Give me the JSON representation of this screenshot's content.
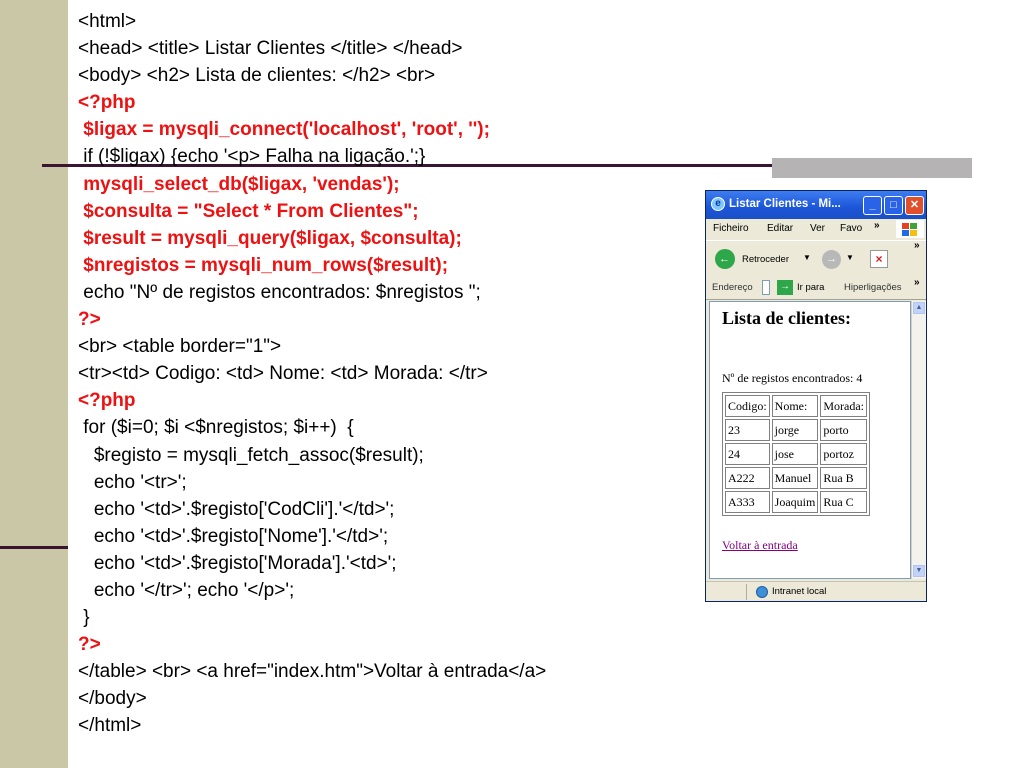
{
  "code_lines": [
    {
      "text": "<html>",
      "red": false
    },
    {
      "text": "<head> <title> Listar Clientes </title> </head>",
      "red": false
    },
    {
      "text": "<body> <h2> Lista de clientes: </h2> <br>",
      "red": false
    },
    {
      "text": "<?php",
      "red": true
    },
    {
      "text": " $ligax = mysqli_connect('localhost', 'root', '');",
      "red": true
    },
    {
      "text": " if (!$ligax) {echo '<p> Falha na ligação.';}",
      "red": false
    },
    {
      "text": " mysqli_select_db($ligax, 'vendas');",
      "red": true
    },
    {
      "text": " $consulta = \"Select * From Clientes\";",
      "red": true
    },
    {
      "text": " $result = mysqli_query($ligax, $consulta);",
      "red": true
    },
    {
      "text": " $nregistos = mysqli_num_rows($result);",
      "red": true
    },
    {
      "text": " echo \"Nº de registos encontrados: $nregistos \";",
      "red": false
    },
    {
      "text": "?>",
      "red": true
    },
    {
      "text": "<br> <table border=\"1\">",
      "red": false
    },
    {
      "text": "<tr><td> Codigo: <td> Nome: <td> Morada: </tr>",
      "red": false
    },
    {
      "text": "<?php",
      "red": true
    },
    {
      "text": " for ($i=0; $i <$nregistos; $i++)  {",
      "red": false
    },
    {
      "text": "   $registo = mysqli_fetch_assoc($result);",
      "red": false
    },
    {
      "text": "   echo '<tr>';",
      "red": false
    },
    {
      "text": "   echo '<td>'.$registo['CodCli'].'</td>';",
      "red": false
    },
    {
      "text": "   echo '<td>'.$registo['Nome'].'</td>';",
      "red": false
    },
    {
      "text": "   echo '<td>'.$registo['Morada'].'<td>';",
      "red": false
    },
    {
      "text": "   echo '</tr>'; echo '</p>';",
      "red": false
    },
    {
      "text": " }",
      "red": false
    },
    {
      "text": "?>",
      "red": true
    },
    {
      "text": "</table> <br> <a href=\"index.htm\">Voltar à entrada</a>",
      "red": false
    },
    {
      "text": "</body>",
      "red": false
    },
    {
      "text": "</html>",
      "red": false
    }
  ],
  "colors": {
    "code_red": "#ee1111",
    "link": "#800080"
  },
  "browser": {
    "title": "Listar Clientes - Mi...",
    "menu": [
      "Ficheiro",
      "Editar",
      "Ver",
      "Favo"
    ],
    "more": "»",
    "back_label": "Retroceder",
    "address_label": "Endereço",
    "go_label": "Ir para",
    "links_label": "Hiperligações",
    "status_text": "Intranet local",
    "page": {
      "heading": "Lista de clientes:",
      "count_text": "Nº de registos encontrados: 4",
      "headers": [
        "Codigo:",
        "Nome:",
        "Morada:"
      ],
      "rows": [
        [
          "23",
          "jorge",
          "porto"
        ],
        [
          "24",
          "jose",
          "portoz"
        ],
        [
          "A222",
          "Manuel",
          "Rua B"
        ],
        [
          "A333",
          "Joaquim",
          "Rua C"
        ]
      ],
      "link_text": "Voltar à entrada"
    }
  }
}
